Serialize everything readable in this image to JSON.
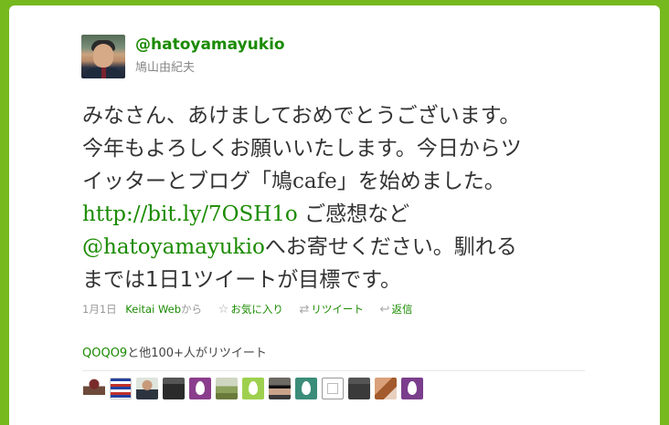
{
  "user": {
    "screen_name": "@hatoyamayukio",
    "real_name": "鳩山由紀夫"
  },
  "tweet": {
    "line1": "みなさん、あけましておめでとうございます。",
    "line2": "今年もよろしくお願いいたします。今日からツ",
    "line3_pre": "イッターとブログ「鳩",
    "line3_cafe": "cafe",
    "line3_post": "」を始めました。",
    "link": "http://bit.ly/7OSH1o",
    "line4_post": " ご感想など",
    "mention": "@hatoyamayukio",
    "line5_post": "へお寄せください。馴れる",
    "line6": "までは1日1ツイートが目標です。"
  },
  "meta": {
    "date": "1月1日",
    "source": "Keitai Web",
    "source_suffix": "から",
    "favorite_label": "お気に入り",
    "retweet_label": "リツイート",
    "reply_label": "返信"
  },
  "retweeters": {
    "user_link": "QOQO9",
    "suffix": "と他100+人がリツイート",
    "avatars": [
      {
        "name": "avatar-1",
        "color": "#ffffff",
        "type": "figure"
      },
      {
        "name": "avatar-2",
        "color": "#e8e8f0",
        "type": "stripes"
      },
      {
        "name": "avatar-3",
        "color": "#dfe5dd",
        "type": "person"
      },
      {
        "name": "avatar-4",
        "color": "#2b2b2b",
        "type": "dark"
      },
      {
        "name": "avatar-5",
        "color": "#8a3d8c",
        "type": "egg"
      },
      {
        "name": "avatar-6",
        "color": "#9aa37a",
        "type": "landscape"
      },
      {
        "name": "avatar-7",
        "color": "#9ed04f",
        "type": "egg"
      },
      {
        "name": "avatar-8",
        "color": "#6d6a63",
        "type": "glasses"
      },
      {
        "name": "avatar-9",
        "color": "#3b8c78",
        "type": "egg"
      },
      {
        "name": "avatar-10",
        "color": "#ffffff",
        "type": "doc"
      },
      {
        "name": "avatar-11",
        "color": "#3a3a3a",
        "type": "dark"
      },
      {
        "name": "avatar-12",
        "color": "#a35a2c",
        "type": "photo"
      },
      {
        "name": "avatar-13",
        "color": "#7a3e8c",
        "type": "egg"
      }
    ]
  }
}
